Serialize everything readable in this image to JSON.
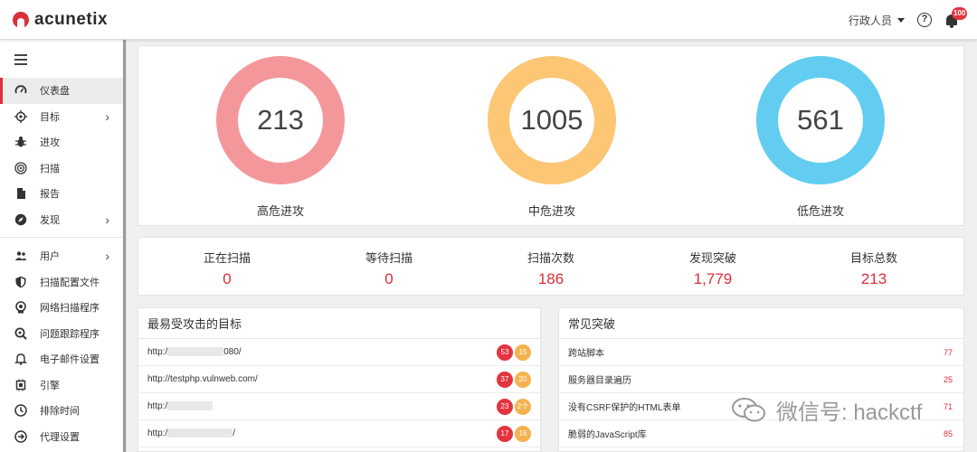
{
  "app": {
    "logo_text": "acunetix"
  },
  "topbar": {
    "user": "行政人员",
    "help_icon": "?",
    "notifications": "100"
  },
  "sidebar": {
    "items": [
      {
        "label": "仪表盘",
        "icon": "gauge-icon",
        "active": true
      },
      {
        "label": "目标",
        "icon": "target-icon",
        "chevron": "›"
      },
      {
        "label": "进攻",
        "icon": "bug-icon"
      },
      {
        "label": "扫描",
        "icon": "radar-icon"
      },
      {
        "label": "报告",
        "icon": "document-icon"
      },
      {
        "label": "发现",
        "icon": "compass-icon",
        "chevron": "›"
      },
      {
        "label": "用户",
        "icon": "users-icon",
        "chevron": "›"
      },
      {
        "label": "扫描配置文件",
        "icon": "shield-icon"
      },
      {
        "label": "网络扫描程序",
        "icon": "network-scanner-icon"
      },
      {
        "label": "问题跟踪程序",
        "icon": "issue-tracker-icon"
      },
      {
        "label": "电子邮件设置",
        "icon": "bell-icon"
      },
      {
        "label": "引擎",
        "icon": "engine-icon"
      },
      {
        "label": "排除时间",
        "icon": "clock-icon"
      },
      {
        "label": "代理设置",
        "icon": "proxy-icon"
      }
    ]
  },
  "severity": [
    {
      "label": "高危进攻",
      "value": "213",
      "color": "#f4979b"
    },
    {
      "label": "中危进攻",
      "value": "1005",
      "color": "#fdc675"
    },
    {
      "label": "低危进攻",
      "value": "561",
      "color": "#62cdf0"
    }
  ],
  "stats": [
    {
      "label": "正在扫描",
      "value": "0"
    },
    {
      "label": "等待扫描",
      "value": "0"
    },
    {
      "label": "扫描次数",
      "value": "186"
    },
    {
      "label": "发现突破",
      "value": "1,779"
    },
    {
      "label": "目标总数",
      "value": "213"
    }
  ],
  "targets": {
    "title": "最易受攻击的目标",
    "rows": [
      {
        "prefix": "http:/",
        "suffix": "080/",
        "red": "53",
        "orange": "15"
      },
      {
        "prefix": "http://testphp.vulnweb.com/",
        "suffix": "",
        "red": "37",
        "orange": "20"
      },
      {
        "prefix": "http:/",
        "suffix": "",
        "red": "23",
        "orange": "2个"
      },
      {
        "prefix": "http:/",
        "suffix": "/",
        "red": "17",
        "orange": "16"
      }
    ]
  },
  "vulns": {
    "title": "常见突破",
    "rows": [
      {
        "name": "跨站脚本",
        "count": "77"
      },
      {
        "name": "服务器目录遍历",
        "count": "25"
      },
      {
        "name": "没有CSRF保护的HTML表单",
        "count": "71"
      },
      {
        "name": "脆弱的JavaScript库",
        "count": "85"
      }
    ]
  },
  "watermark": {
    "text": "微信号: hackctf"
  }
}
